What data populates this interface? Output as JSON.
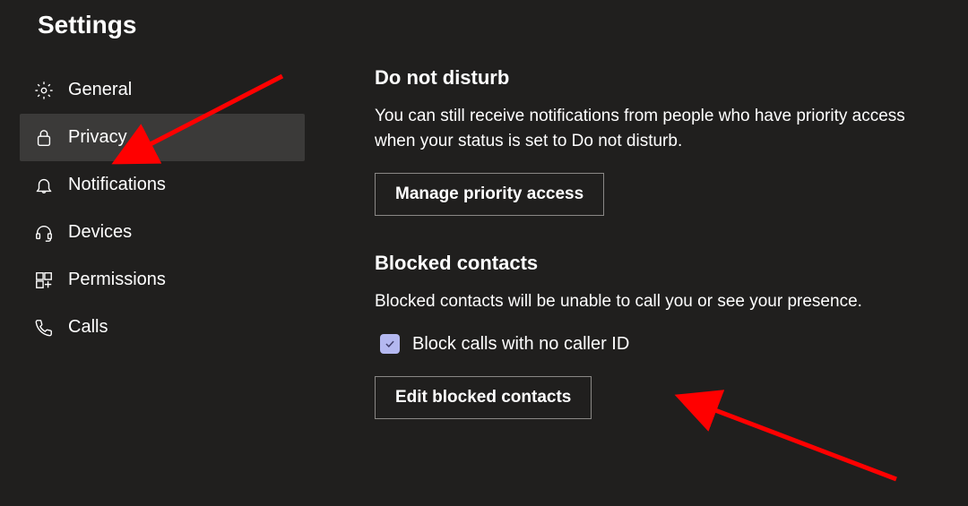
{
  "title": "Settings",
  "sidebar": {
    "items": [
      {
        "label": "General",
        "icon": "gear-icon",
        "active": false
      },
      {
        "label": "Privacy",
        "icon": "lock-icon",
        "active": true
      },
      {
        "label": "Notifications",
        "icon": "bell-icon",
        "active": false
      },
      {
        "label": "Devices",
        "icon": "headset-icon",
        "active": false
      },
      {
        "label": "Permissions",
        "icon": "permissions-icon",
        "active": false
      },
      {
        "label": "Calls",
        "icon": "phone-icon",
        "active": false
      }
    ]
  },
  "main": {
    "dnd": {
      "heading": "Do not disturb",
      "desc": "You can still receive notifications from people who have priority access when your status is set to Do not disturb.",
      "button": "Manage priority access"
    },
    "blocked": {
      "heading": "Blocked contacts",
      "desc": "Blocked contacts will be unable to call you or see your presence.",
      "checkbox_label": "Block calls with no caller ID",
      "checkbox_checked": true,
      "button": "Edit blocked contacts"
    }
  },
  "annotations": {
    "arrow_color": "#ff0000"
  }
}
